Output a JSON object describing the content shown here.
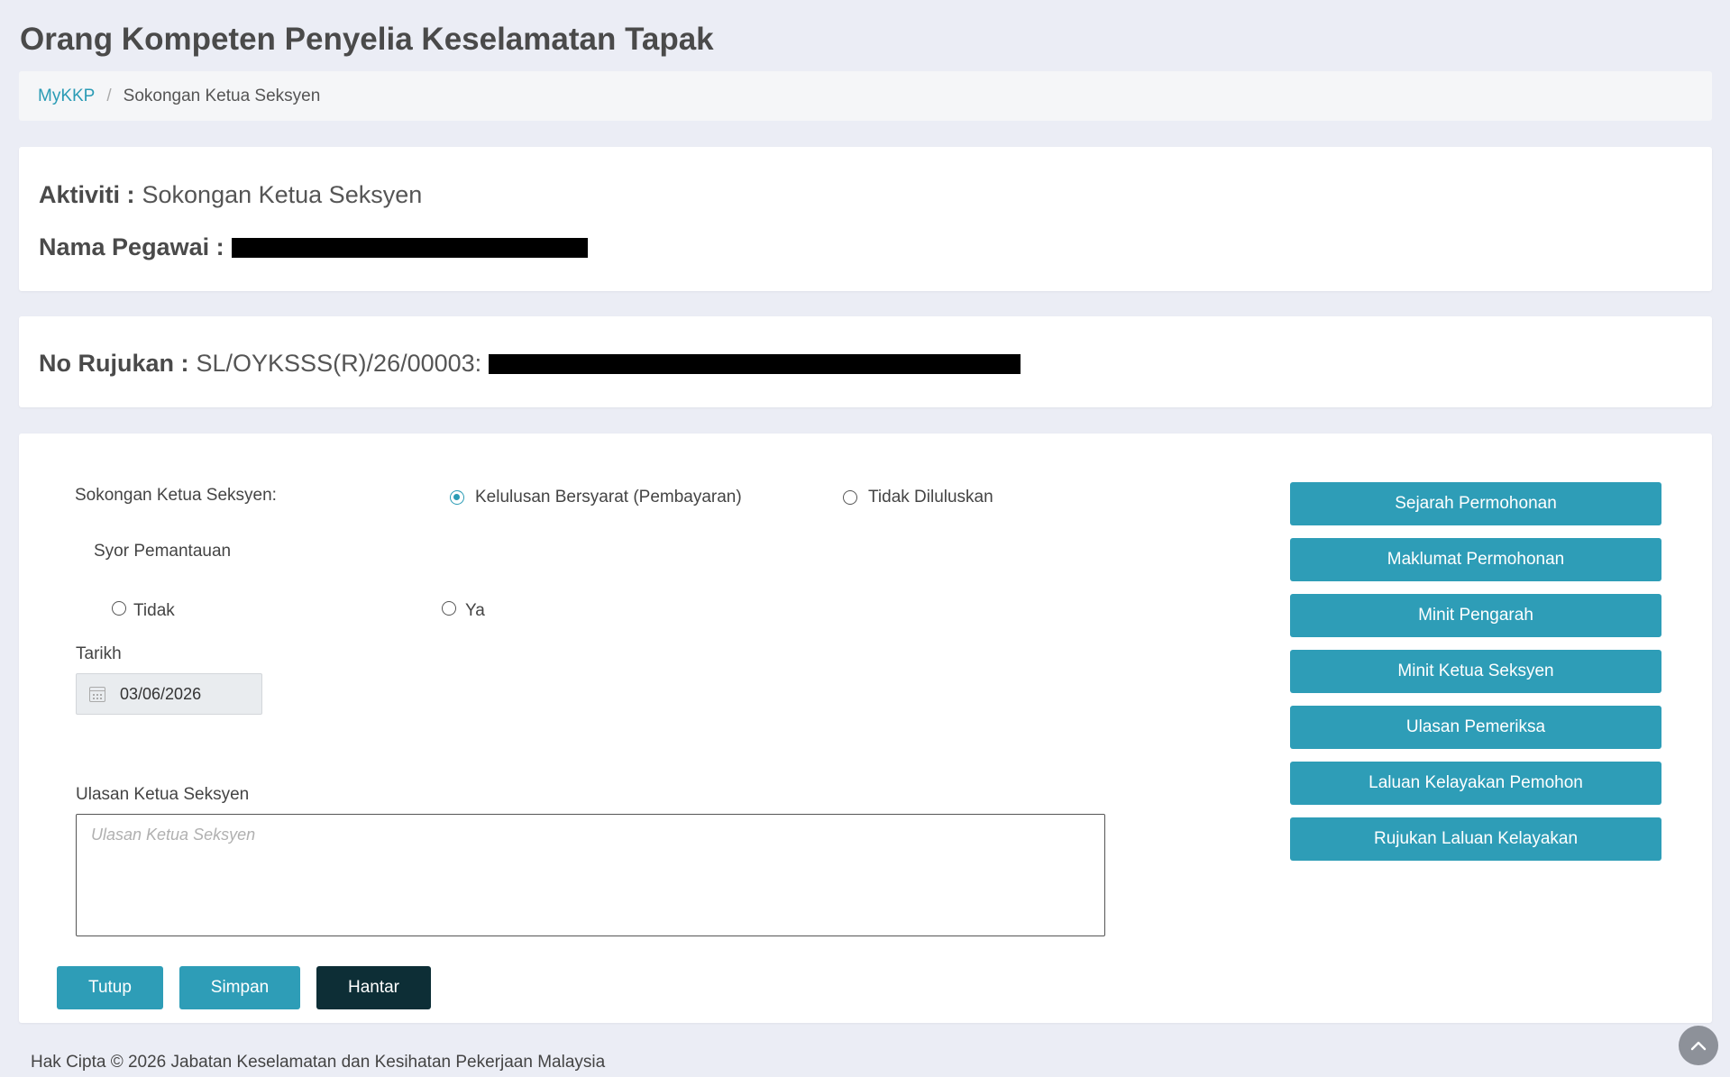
{
  "header": {
    "title_bold": "Orang Kompeten",
    "title_rest": "Penyelia Keselamatan Tapak"
  },
  "breadcrumb": {
    "home": "MyKKP",
    "separator": "/",
    "current": "Sokongan Ketua Seksyen"
  },
  "activity": {
    "label": "Aktiviti :",
    "value": "Sokongan Ketua Seksyen",
    "officer_label": "Nama Pegawai :"
  },
  "reference": {
    "label": "No Rujukan :",
    "value": "SL/OYKSSS(R)/26/00003:"
  },
  "form": {
    "support_label": "Sokongan Ketua Seksyen:",
    "support_options": [
      {
        "label": "Kelulusan Bersyarat (Pembayaran)",
        "checked": true
      },
      {
        "label": "Tidak Diluluskan",
        "checked": false
      }
    ],
    "monitoring_label": "Syor Pemantauan",
    "monitoring_options": [
      {
        "label": "Tidak",
        "checked": false
      },
      {
        "label": "Ya",
        "checked": false
      }
    ],
    "date_label": "Tarikh",
    "date_value": "03/06/2026",
    "comment_label": "Ulasan Ketua Seksyen",
    "comment_placeholder": "Ulasan Ketua Seksyen",
    "comment_value": ""
  },
  "actions": {
    "close": "Tutup",
    "save": "Simpan",
    "submit": "Hantar"
  },
  "side_buttons": [
    "Sejarah Permohonan",
    "Maklumat Permohonan",
    "Minit Pengarah",
    "Minit Ketua Seksyen",
    "Ulasan Pemeriksa",
    "Laluan Kelayakan Pemohon",
    "Rujukan Laluan Kelayakan"
  ],
  "footer": {
    "copyright": "Hak Cipta © 2026 Jabatan Keselamatan dan Kesihatan Pekerjaan Malaysia"
  },
  "colors": {
    "accent": "#2e9db7",
    "dark_button": "#0d2e36",
    "background": "#ebedf5"
  }
}
